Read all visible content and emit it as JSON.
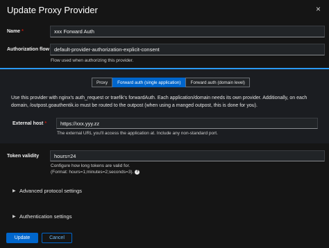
{
  "modal": {
    "title": "Update Proxy Provider",
    "close_icon": "×"
  },
  "form": {
    "name": {
      "label": "Name",
      "required": "*",
      "value": "xxx Forward Auth"
    },
    "auth_flow": {
      "label": "Authorization flow",
      "required": "*",
      "value": "default-provider-authorization-explicit-consent",
      "helper": "Flow used when authorizing this provider."
    },
    "tabs": [
      "Proxy",
      "Forward auth (single application)",
      "Forward auth (domain level)"
    ],
    "active_tab": 1,
    "description": "Use this provider with nginx's auth_request or traefik's forwardAuth. Each application/domain needs its own provider. Additionally, on each domain, /outpost.goauthentik.io must be routed to the outpost (when using a manged outpost, this is done for you).",
    "external_host": {
      "label": "External host",
      "required": "*",
      "value": "https://xxx.yyy.zz",
      "helper": "The external URL you'll access the application at. Include any non-standard port."
    },
    "token_validity": {
      "label": "Token validity",
      "value": "hours=24",
      "helper1": "Configure how long tokens are valid for.",
      "helper2": "(Format: hours=1;minutes=2;seconds=3).",
      "help_icon": "?"
    },
    "sections": [
      "Advanced protocol settings",
      "Authentication settings"
    ]
  },
  "footer": {
    "update": "Update",
    "cancel": "Cancel"
  },
  "colors": {
    "accent": "#0066cc",
    "required": "#c9190b",
    "background": "#151515"
  }
}
